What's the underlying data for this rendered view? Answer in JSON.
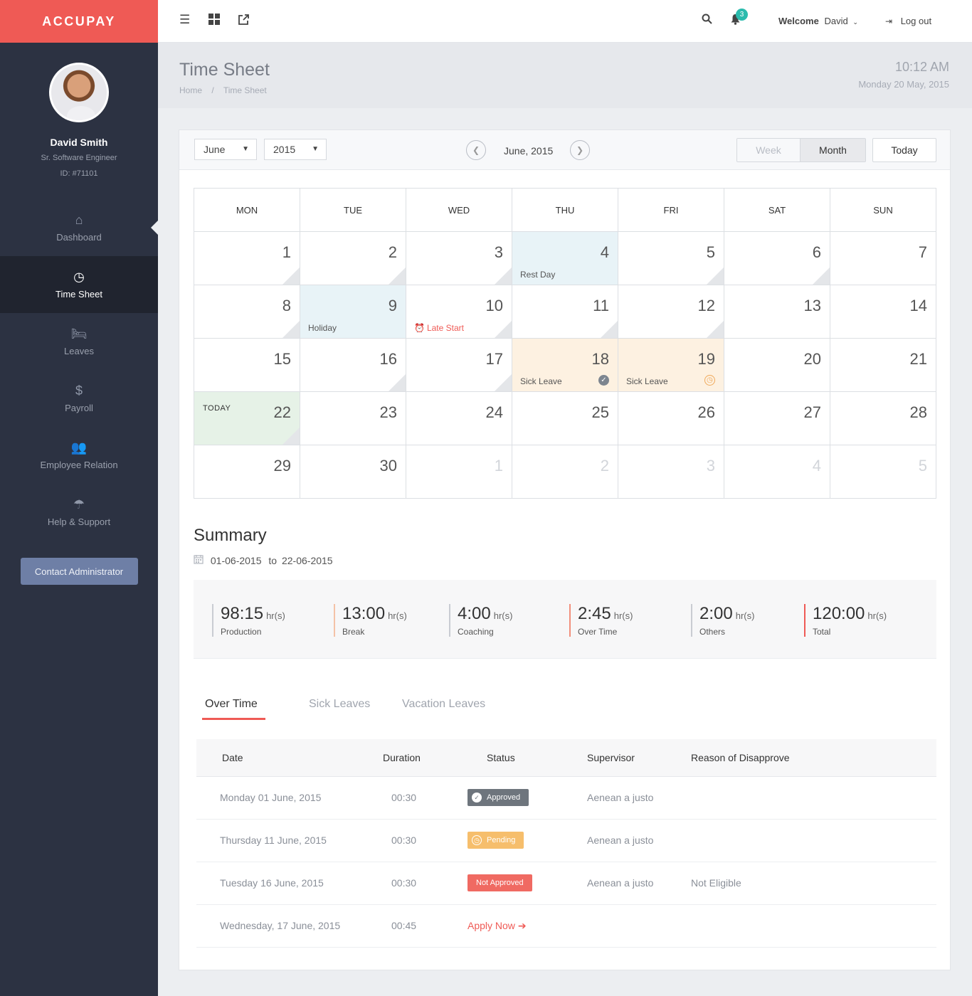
{
  "brand": "ACCUPAY",
  "profile": {
    "name": "David Smith",
    "title": "Sr. Software Engineer",
    "id": "ID: #71101"
  },
  "nav": [
    {
      "label": "Dashboard",
      "icon": "home-icon",
      "glyph": "⌂"
    },
    {
      "label": "Time Sheet",
      "icon": "clock-icon",
      "glyph": "◷"
    },
    {
      "label": "Leaves",
      "icon": "bed-icon",
      "glyph": "🛏"
    },
    {
      "label": "Payroll",
      "icon": "dollar-icon",
      "glyph": "$"
    },
    {
      "label": "Employee Relation",
      "icon": "users-icon",
      "glyph": "👥"
    },
    {
      "label": "Help & Support",
      "icon": "umbrella-icon",
      "glyph": "☂"
    }
  ],
  "contact_button": "Contact Administrator",
  "topbar": {
    "notification_count": "3",
    "welcome_label": "Welcome",
    "welcome_user": "David",
    "logout_label": "Log out"
  },
  "header": {
    "title": "Time Sheet",
    "breadcrumb_home": "Home",
    "breadcrumb_sep": "/",
    "breadcrumb_current": "Time Sheet",
    "time": "10:12 AM",
    "date": "Monday 20 May, 2015"
  },
  "controls": {
    "month_select": "June",
    "year_select": "2015",
    "current_label": "June, 2015",
    "week_label": "Week",
    "month_label": "Month",
    "today_label": "Today"
  },
  "calendar": {
    "weekdays": [
      "MON",
      "TUE",
      "WED",
      "THU",
      "FRI",
      "SAT",
      "SUN"
    ],
    "weeks": [
      [
        {
          "day": "1",
          "corner": true
        },
        {
          "day": "2",
          "corner": true
        },
        {
          "day": "3",
          "corner": true
        },
        {
          "day": "4",
          "type": "rest",
          "event": "Rest Day"
        },
        {
          "day": "5",
          "corner": true
        },
        {
          "day": "6",
          "corner": true
        },
        {
          "day": "7"
        }
      ],
      [
        {
          "day": "8",
          "corner": true
        },
        {
          "day": "9",
          "type": "holiday",
          "event": "Holiday"
        },
        {
          "day": "10",
          "event": "Late Start",
          "event_style": "red",
          "event_icon": "alarm-icon",
          "corner": true
        },
        {
          "day": "11",
          "corner": true
        },
        {
          "day": "12",
          "corner": true
        },
        {
          "day": "13"
        },
        {
          "day": "14"
        }
      ],
      [
        {
          "day": "15"
        },
        {
          "day": "16",
          "corner": true
        },
        {
          "day": "17",
          "corner": true
        },
        {
          "day": "18",
          "type": "sick",
          "event": "Sick Leave",
          "status_icon": "check-circle-icon"
        },
        {
          "day": "19",
          "type": "sick",
          "event": "Sick Leave",
          "status_icon": "pending-clock-icon"
        },
        {
          "day": "20"
        },
        {
          "day": "21"
        }
      ],
      [
        {
          "day": "22",
          "type": "today",
          "label": "TODAY",
          "corner": true
        },
        {
          "day": "23"
        },
        {
          "day": "24"
        },
        {
          "day": "25"
        },
        {
          "day": "26"
        },
        {
          "day": "27"
        },
        {
          "day": "28"
        }
      ],
      [
        {
          "day": "29"
        },
        {
          "day": "30"
        },
        {
          "day": "1",
          "muted": true
        },
        {
          "day": "2",
          "muted": true
        },
        {
          "day": "3",
          "muted": true
        },
        {
          "day": "4",
          "muted": true
        },
        {
          "day": "5",
          "muted": true
        }
      ]
    ]
  },
  "summary": {
    "title": "Summary",
    "range_from": "01-06-2015",
    "range_sep": "to",
    "range_to": "22-06-2015",
    "stats": [
      {
        "value": "98:15",
        "unit": "hr(s)",
        "label": "Production",
        "color": "#c9ccd2"
      },
      {
        "value": "13:00",
        "unit": "hr(s)",
        "label": "Break",
        "color": "#f4c2a7"
      },
      {
        "value": "4:00",
        "unit": "hr(s)",
        "label": "Coaching",
        "color": "#c9ccd2"
      },
      {
        "value": "2:45",
        "unit": "hr(s)",
        "label": "Over Time",
        "color": "#f28f7c"
      },
      {
        "value": "2:00",
        "unit": "hr(s)",
        "label": "Others",
        "color": "#c9ccd2"
      },
      {
        "value": "120:00",
        "unit": "hr(s)",
        "label": "Total",
        "color": "#ef5a55"
      }
    ]
  },
  "tabs": [
    "Over Time",
    "Sick Leaves",
    "Vacation Leaves"
  ],
  "table": {
    "headers": [
      "Date",
      "Duration",
      "Status",
      "Supervisor",
      "Reason of Disapprove"
    ],
    "rows": [
      {
        "date": "Monday 01 June, 2015",
        "duration": "00:30",
        "status": "Approved",
        "status_kind": "approved",
        "supervisor": "Aenean a justo",
        "reason": ""
      },
      {
        "date": "Thursday 11 June, 2015",
        "duration": "00:30",
        "status": "Pending",
        "status_kind": "pending",
        "supervisor": "Aenean a justo",
        "reason": ""
      },
      {
        "date": "Tuesday 16 June, 2015",
        "duration": "00:30",
        "status": "Not Approved",
        "status_kind": "notapproved",
        "supervisor": "Aenean a justo",
        "reason": "Not Eligible"
      },
      {
        "date": "Wednesday, 17 June, 2015",
        "duration": "00:45",
        "status": "Apply Now",
        "status_kind": "apply",
        "supervisor": "",
        "reason": ""
      }
    ]
  }
}
